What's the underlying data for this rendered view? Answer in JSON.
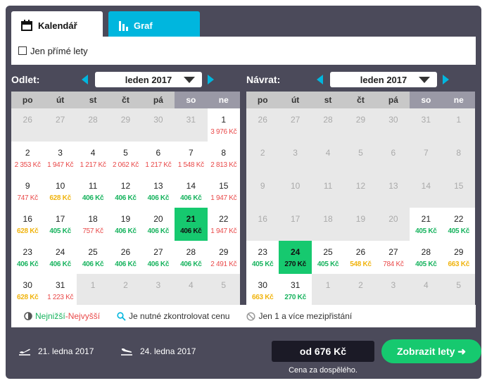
{
  "tabs": {
    "calendar": "Kalendář",
    "graph": "Graf"
  },
  "filter": {
    "direct_only": "Jen přímé lety"
  },
  "weekdays": [
    "po",
    "út",
    "st",
    "čt",
    "pá",
    "so",
    "ne"
  ],
  "outbound": {
    "label": "Odlet:",
    "month": "leden 2017",
    "cells": [
      {
        "d": "26",
        "p": "",
        "s": "off",
        "c": ""
      },
      {
        "d": "27",
        "p": "",
        "s": "off",
        "c": ""
      },
      {
        "d": "28",
        "p": "",
        "s": "off",
        "c": ""
      },
      {
        "d": "29",
        "p": "",
        "s": "off",
        "c": ""
      },
      {
        "d": "30",
        "p": "",
        "s": "off",
        "c": ""
      },
      {
        "d": "31",
        "p": "",
        "s": "off",
        "c": ""
      },
      {
        "d": "1",
        "p": "3 976 Kč",
        "s": "",
        "c": "r"
      },
      {
        "d": "2",
        "p": "2 353 Kč",
        "s": "",
        "c": "r"
      },
      {
        "d": "3",
        "p": "1 947 Kč",
        "s": "",
        "c": "r"
      },
      {
        "d": "4",
        "p": "1 217 Kč",
        "s": "",
        "c": "r"
      },
      {
        "d": "5",
        "p": "2 062 Kč",
        "s": "",
        "c": "r"
      },
      {
        "d": "6",
        "p": "1 217 Kč",
        "s": "",
        "c": "r"
      },
      {
        "d": "7",
        "p": "1 548 Kč",
        "s": "",
        "c": "r"
      },
      {
        "d": "8",
        "p": "2 813 Kč",
        "s": "",
        "c": "r"
      },
      {
        "d": "9",
        "p": "747 Kč",
        "s": "",
        "c": "r"
      },
      {
        "d": "10",
        "p": "628 Kč",
        "s": "",
        "c": "o"
      },
      {
        "d": "11",
        "p": "406 Kč",
        "s": "",
        "c": "g"
      },
      {
        "d": "12",
        "p": "406 Kč",
        "s": "",
        "c": "g"
      },
      {
        "d": "13",
        "p": "406 Kč",
        "s": "",
        "c": "g"
      },
      {
        "d": "14",
        "p": "406 Kč",
        "s": "",
        "c": "g"
      },
      {
        "d": "15",
        "p": "1 947 Kč",
        "s": "",
        "c": "r"
      },
      {
        "d": "16",
        "p": "628 Kč",
        "s": "",
        "c": "o"
      },
      {
        "d": "17",
        "p": "405 Kč",
        "s": "",
        "c": "g"
      },
      {
        "d": "18",
        "p": "757 Kč",
        "s": "",
        "c": "r"
      },
      {
        "d": "19",
        "p": "406 Kč",
        "s": "",
        "c": "g"
      },
      {
        "d": "20",
        "p": "406 Kč",
        "s": "",
        "c": "g"
      },
      {
        "d": "21",
        "p": "406 Kč",
        "s": "sel",
        "c": "g"
      },
      {
        "d": "22",
        "p": "1 947 Kč",
        "s": "",
        "c": "r"
      },
      {
        "d": "23",
        "p": "406 Kč",
        "s": "",
        "c": "g"
      },
      {
        "d": "24",
        "p": "406 Kč",
        "s": "",
        "c": "g"
      },
      {
        "d": "25",
        "p": "406 Kč",
        "s": "",
        "c": "g"
      },
      {
        "d": "26",
        "p": "406 Kč",
        "s": "",
        "c": "g"
      },
      {
        "d": "27",
        "p": "406 Kč",
        "s": "",
        "c": "g"
      },
      {
        "d": "28",
        "p": "406 Kč",
        "s": "",
        "c": "g"
      },
      {
        "d": "29",
        "p": "2 491 Kč",
        "s": "",
        "c": "r"
      },
      {
        "d": "30",
        "p": "628 Kč",
        "s": "",
        "c": "o"
      },
      {
        "d": "31",
        "p": "1 223 Kč",
        "s": "",
        "c": "r"
      },
      {
        "d": "1",
        "p": "",
        "s": "off",
        "c": ""
      },
      {
        "d": "2",
        "p": "",
        "s": "off",
        "c": ""
      },
      {
        "d": "3",
        "p": "",
        "s": "off",
        "c": ""
      },
      {
        "d": "4",
        "p": "",
        "s": "off",
        "c": ""
      },
      {
        "d": "5",
        "p": "",
        "s": "off",
        "c": ""
      }
    ]
  },
  "return": {
    "label": "Návrat:",
    "month": "leden 2017",
    "cells": [
      {
        "d": "26",
        "p": "",
        "s": "off",
        "c": ""
      },
      {
        "d": "27",
        "p": "",
        "s": "off",
        "c": ""
      },
      {
        "d": "28",
        "p": "",
        "s": "off",
        "c": ""
      },
      {
        "d": "29",
        "p": "",
        "s": "off",
        "c": ""
      },
      {
        "d": "30",
        "p": "",
        "s": "off",
        "c": ""
      },
      {
        "d": "31",
        "p": "",
        "s": "off",
        "c": ""
      },
      {
        "d": "1",
        "p": "",
        "s": "off",
        "c": ""
      },
      {
        "d": "2",
        "p": "",
        "s": "off",
        "c": ""
      },
      {
        "d": "3",
        "p": "",
        "s": "off",
        "c": ""
      },
      {
        "d": "4",
        "p": "",
        "s": "off",
        "c": ""
      },
      {
        "d": "5",
        "p": "",
        "s": "off",
        "c": ""
      },
      {
        "d": "6",
        "p": "",
        "s": "off",
        "c": ""
      },
      {
        "d": "7",
        "p": "",
        "s": "off",
        "c": ""
      },
      {
        "d": "8",
        "p": "",
        "s": "off",
        "c": ""
      },
      {
        "d": "9",
        "p": "",
        "s": "off",
        "c": ""
      },
      {
        "d": "10",
        "p": "",
        "s": "off",
        "c": ""
      },
      {
        "d": "11",
        "p": "",
        "s": "off",
        "c": ""
      },
      {
        "d": "12",
        "p": "",
        "s": "off",
        "c": ""
      },
      {
        "d": "13",
        "p": "",
        "s": "off",
        "c": ""
      },
      {
        "d": "14",
        "p": "",
        "s": "off",
        "c": ""
      },
      {
        "d": "15",
        "p": "",
        "s": "off",
        "c": ""
      },
      {
        "d": "16",
        "p": "",
        "s": "off",
        "c": ""
      },
      {
        "d": "17",
        "p": "",
        "s": "off",
        "c": ""
      },
      {
        "d": "18",
        "p": "",
        "s": "off",
        "c": ""
      },
      {
        "d": "19",
        "p": "",
        "s": "off",
        "c": ""
      },
      {
        "d": "20",
        "p": "",
        "s": "off",
        "c": ""
      },
      {
        "d": "21",
        "p": "405 Kč",
        "s": "",
        "c": "g"
      },
      {
        "d": "22",
        "p": "405 Kč",
        "s": "",
        "c": "g"
      },
      {
        "d": "23",
        "p": "405 Kč",
        "s": "",
        "c": "g"
      },
      {
        "d": "24",
        "p": "270 Kč",
        "s": "sel",
        "c": "g"
      },
      {
        "d": "25",
        "p": "405 Kč",
        "s": "",
        "c": "g"
      },
      {
        "d": "26",
        "p": "548 Kč",
        "s": "",
        "c": "o"
      },
      {
        "d": "27",
        "p": "784 Kč",
        "s": "",
        "c": "r"
      },
      {
        "d": "28",
        "p": "405 Kč",
        "s": "",
        "c": "g"
      },
      {
        "d": "29",
        "p": "663 Kč",
        "s": "",
        "c": "o"
      },
      {
        "d": "30",
        "p": "663 Kč",
        "s": "",
        "c": "o"
      },
      {
        "d": "31",
        "p": "270 Kč",
        "s": "",
        "c": "g"
      },
      {
        "d": "1",
        "p": "",
        "s": "off",
        "c": ""
      },
      {
        "d": "2",
        "p": "",
        "s": "off",
        "c": ""
      },
      {
        "d": "3",
        "p": "",
        "s": "off",
        "c": ""
      },
      {
        "d": "4",
        "p": "",
        "s": "off",
        "c": ""
      },
      {
        "d": "5",
        "p": "",
        "s": "off",
        "c": ""
      }
    ]
  },
  "legend": {
    "lowest": "Nejnižší",
    "separator": " - ",
    "highest": "Nejvyšší",
    "check_price": "Je nutné zkontrolovat cenu",
    "stops": "Jen 1 a více mezipřistání"
  },
  "footer": {
    "depart_date": "21. ledna 2017",
    "return_date": "24. ledna 2017",
    "price": "od 676 Kč",
    "price_note": "Cena za dospělého.",
    "show_button": "Zobrazit lety ➜"
  },
  "colors": {
    "accent": "#00b6de",
    "green": "#16c96f",
    "dark": "#4b4a5a"
  }
}
